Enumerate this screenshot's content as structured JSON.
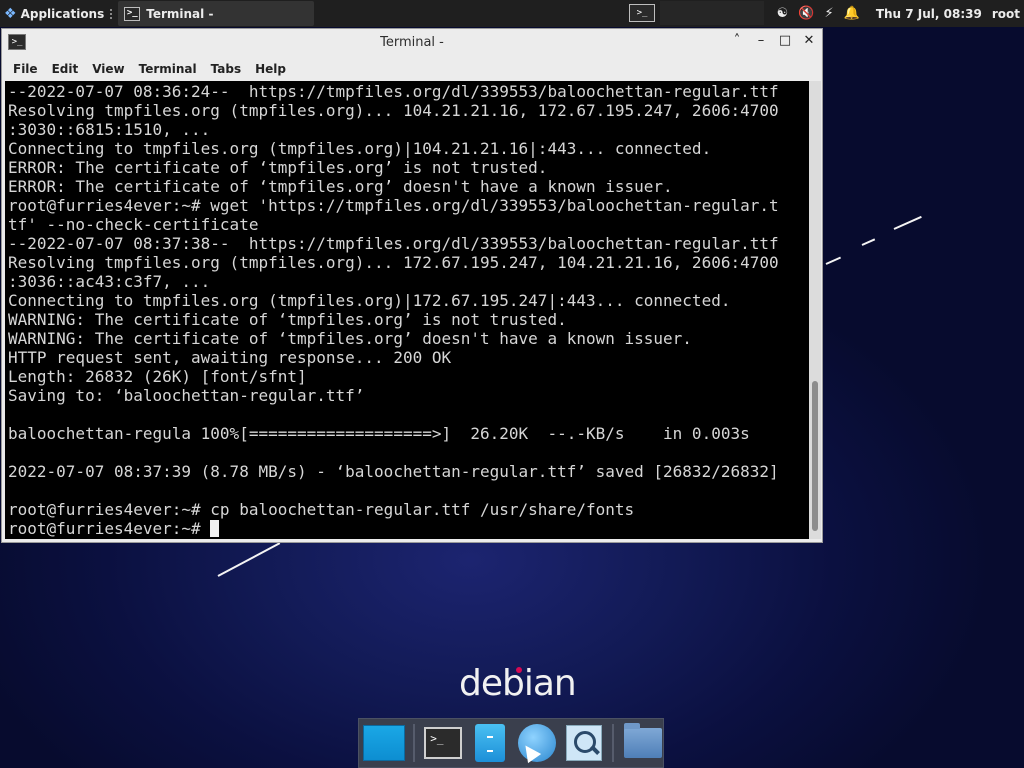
{
  "panel": {
    "applications_label": "Applications",
    "task_label": "Terminal -",
    "clock": "Thu 7 Jul, 08:39",
    "user": "root"
  },
  "window": {
    "title": "Terminal -",
    "minimize": "–",
    "maximize": "□",
    "close": "✕",
    "shade": "˄"
  },
  "menu": [
    "File",
    "Edit",
    "View",
    "Terminal",
    "Tabs",
    "Help"
  ],
  "terminal": {
    "lines": [
      "--2022-07-07 08:36:24--  https://tmpfiles.org/dl/339553/baloochettan-regular.ttf",
      "Resolving tmpfiles.org (tmpfiles.org)... 104.21.21.16, 172.67.195.247, 2606:4700",
      ":3030::6815:1510, ...",
      "Connecting to tmpfiles.org (tmpfiles.org)|104.21.21.16|:443... connected.",
      "ERROR: The certificate of ‘tmpfiles.org’ is not trusted.",
      "ERROR: The certificate of ‘tmpfiles.org’ doesn't have a known issuer.",
      "root@furries4ever:~# wget 'https://tmpfiles.org/dl/339553/baloochettan-regular.t",
      "tf' --no-check-certificate",
      "--2022-07-07 08:37:38--  https://tmpfiles.org/dl/339553/baloochettan-regular.ttf",
      "Resolving tmpfiles.org (tmpfiles.org)... 172.67.195.247, 104.21.21.16, 2606:4700",
      ":3036::ac43:c3f7, ...",
      "Connecting to tmpfiles.org (tmpfiles.org)|172.67.195.247|:443... connected.",
      "WARNING: The certificate of ‘tmpfiles.org’ is not trusted.",
      "WARNING: The certificate of ‘tmpfiles.org’ doesn't have a known issuer.",
      "HTTP request sent, awaiting response... 200 OK",
      "Length: 26832 (26K) [font/sfnt]",
      "Saving to: ‘baloochettan-regular.ttf’",
      "",
      "baloochettan-regula 100%[===================>]  26.20K  --.-KB/s    in 0.003s",
      "",
      "2022-07-07 08:37:39 (8.78 MB/s) - ‘baloochettan-regular.ttf’ saved [26832/26832]",
      "",
      "root@furries4ever:~# cp baloochettan-regular.ttf /usr/share/fonts"
    ],
    "prompt": "root@furries4ever:~# "
  },
  "desktop": {
    "logo_text": "debian"
  },
  "dock": [
    {
      "name": "show-desktop",
      "icon": "desktop-icon"
    },
    {
      "name": "terminal",
      "icon": "terminal-icon"
    },
    {
      "name": "file-manager",
      "icon": "file-manager-icon"
    },
    {
      "name": "web-browser",
      "icon": "web-browser-icon"
    },
    {
      "name": "app-finder",
      "icon": "search-icon"
    },
    {
      "name": "home-folder",
      "icon": "folder-icon"
    }
  ],
  "colors": {
    "terminal_bg": "#000000",
    "terminal_fg": "#d6d6d6",
    "panel_bg": "#1f1f1f",
    "desktop_bg": "#0b1040"
  }
}
